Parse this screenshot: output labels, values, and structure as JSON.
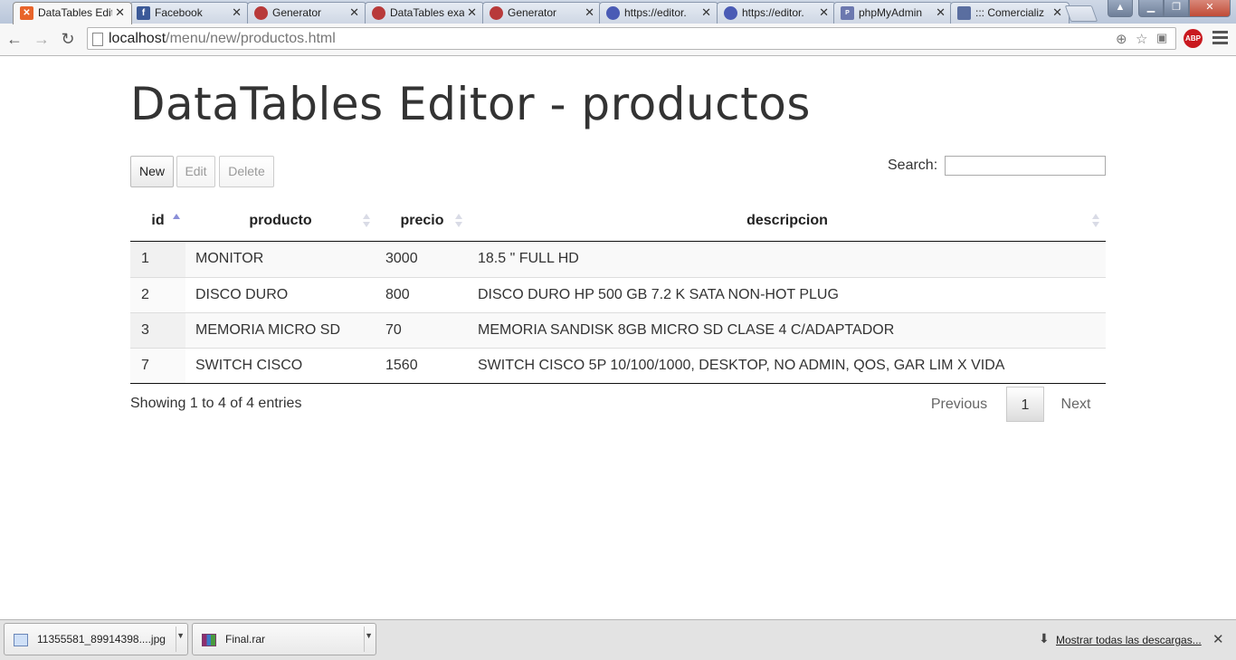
{
  "browser": {
    "tabs": [
      {
        "title": "DataTables Editor",
        "icon": "xampp-icon",
        "color": "#e8642a",
        "active": true
      },
      {
        "title": "Facebook",
        "icon": "facebook-icon",
        "color": "#3b5998"
      },
      {
        "title": "Generator",
        "icon": "generator-icon",
        "color": "#b83a3a"
      },
      {
        "title": "DataTables example",
        "icon": "generator-icon",
        "color": "#b83a3a"
      },
      {
        "title": "Generator",
        "icon": "generator-icon",
        "color": "#b83a3a"
      },
      {
        "title": "https://editor.",
        "icon": "globe-icon",
        "color": "#4a5bb5"
      },
      {
        "title": "https://editor.",
        "icon": "globe-icon",
        "color": "#4a5bb5"
      },
      {
        "title": "phpMyAdmin",
        "icon": "phpmyadmin-icon",
        "color": "#6c78af"
      },
      {
        "title": "::: Comercializ",
        "icon": "site-icon",
        "color": "#5a6ea0"
      }
    ],
    "url_host": "localhost",
    "url_path": "/menu/new/productos.html"
  },
  "page": {
    "title": "DataTables Editor - productos",
    "buttons": {
      "new": "New",
      "edit": "Edit",
      "delete": "Delete"
    },
    "search_label": "Search:",
    "search_value": ""
  },
  "table": {
    "columns": [
      "id",
      "producto",
      "precio",
      "descripcion"
    ],
    "rows": [
      {
        "id": "1",
        "producto": "MONITOR",
        "precio": "3000",
        "descripcion": "18.5 \" FULL HD"
      },
      {
        "id": "2",
        "producto": "DISCO DURO",
        "precio": "800",
        "descripcion": "DISCO DURO HP 500 GB 7.2 K SATA NON-HOT PLUG"
      },
      {
        "id": "3",
        "producto": "MEMORIA MICRO SD",
        "precio": "70",
        "descripcion": "MEMORIA SANDISK 8GB MICRO SD CLASE 4 C/ADAPTADOR"
      },
      {
        "id": "7",
        "producto": "SWITCH CISCO",
        "precio": "1560",
        "descripcion": "SWITCH CISCO 5P 10/100/1000, DESKTOP, NO ADMIN, QOS, GAR LIM X VIDA"
      }
    ],
    "info": "Showing 1 to 4 of 4 entries",
    "pagination": {
      "previous": "Previous",
      "current": "1",
      "next": "Next"
    }
  },
  "downloads": {
    "items": [
      {
        "name": "11355581_89914398....jpg",
        "icon": "image-file-icon"
      },
      {
        "name": "Final.rar",
        "icon": "rar-file-icon"
      }
    ],
    "show_all": "Mostrar todas las descargas..."
  }
}
